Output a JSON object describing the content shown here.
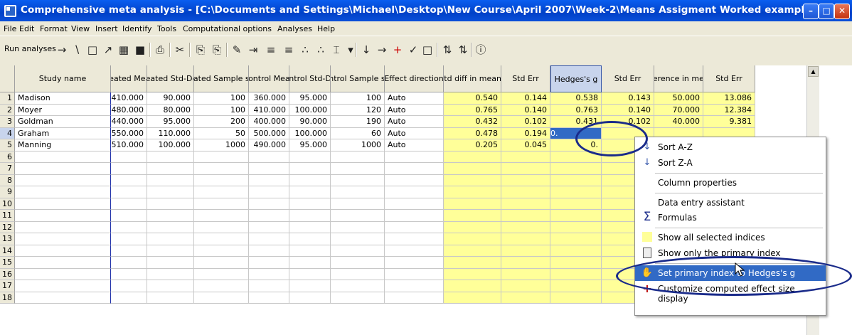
{
  "window": {
    "title": "Comprehensive meta analysis - [C:\\Documents and Settings\\Michael\\Desktop\\New Course\\April 2007\\Week-2\\Means Assigment Worked example.cma]",
    "min_glyph": "–",
    "max_glyph": "□",
    "close_glyph": "✕"
  },
  "menu": [
    "File",
    "Edit",
    "Format",
    "View",
    "Insert",
    "Identify",
    "Tools",
    "Computational options",
    "Analyses",
    "Help"
  ],
  "toolbar": {
    "run_label": "Run analyses",
    "icons": [
      "→",
      "∖",
      "□",
      "↗",
      "▦",
      "■",
      "⎙",
      "✂",
      "⎘",
      "⎘",
      "✎",
      "⇥",
      "≡",
      "≡",
      "∴",
      "∴",
      "⌶",
      "▾",
      "↓",
      "→",
      "+",
      "✓",
      "□",
      "⇅",
      "⇅",
      "ⓘ"
    ]
  },
  "grid": {
    "columns": [
      "Study name",
      "Treated Mean",
      "Treated Std-Dev",
      "Treated Sample size",
      "Control Mean",
      "Control Std-Dev",
      "Control Sample size",
      "Effect direction",
      "Std diff in means",
      "Std Err",
      "Hedges's g",
      "Std Err",
      "Difference in means",
      "Std Err"
    ],
    "rows": [
      {
        "n": "1",
        "name": "Madison",
        "tm": "410.000",
        "tsd": "90.000",
        "tn": "100",
        "cm": "360.000",
        "csd": "95.000",
        "cn": "100",
        "dir": "Auto",
        "d": "0.540",
        "dse": "0.144",
        "g": "0.538",
        "gse": "0.143",
        "diff": "50.000",
        "diffse": "13.086"
      },
      {
        "n": "2",
        "name": "Moyer",
        "tm": "480.000",
        "tsd": "80.000",
        "tn": "100",
        "cm": "410.000",
        "csd": "100.000",
        "cn": "120",
        "dir": "Auto",
        "d": "0.765",
        "dse": "0.140",
        "g": "0.763",
        "gse": "0.140",
        "diff": "70.000",
        "diffse": "12.384"
      },
      {
        "n": "3",
        "name": "Goldman",
        "tm": "440.000",
        "tsd": "95.000",
        "tn": "200",
        "cm": "400.000",
        "csd": "90.000",
        "cn": "190",
        "dir": "Auto",
        "d": "0.432",
        "dse": "0.102",
        "g": "0.431",
        "gse": "0.102",
        "diff": "40.000",
        "diffse": "9.381"
      },
      {
        "n": "4",
        "name": "Graham",
        "tm": "550.000",
        "tsd": "110.000",
        "tn": "50",
        "cm": "500.000",
        "csd": "100.000",
        "cn": "60",
        "dir": "Auto",
        "d": "0.478",
        "dse": "0.194",
        "g": "0.",
        "gse": "",
        "diff": "",
        "diffse": ""
      },
      {
        "n": "5",
        "name": "Manning",
        "tm": "510.000",
        "tsd": "100.000",
        "tn": "1000",
        "cm": "490.000",
        "csd": "95.000",
        "cn": "1000",
        "dir": "Auto",
        "d": "0.205",
        "dse": "0.045",
        "g": "0.",
        "gse": "",
        "diff": "",
        "diffse": ""
      }
    ],
    "empty_rows": [
      "6",
      "7",
      "8",
      "9",
      "10",
      "11",
      "12",
      "13",
      "14",
      "15",
      "16",
      "17",
      "18"
    ]
  },
  "context_menu": {
    "items": [
      {
        "icon": "↓",
        "label": "Sort A-Z"
      },
      {
        "icon": "↓",
        "label": "Sort Z-A"
      },
      {
        "icon": "",
        "label": "Column properties"
      },
      {
        "icon": "",
        "label": "Data entry assistant"
      },
      {
        "icon": "Σ",
        "label": "Formulas"
      },
      {
        "icon": "",
        "label": "Show all selected indices"
      },
      {
        "icon": "",
        "label": "Show only the primary index"
      },
      {
        "icon": "✋",
        "label": "Set primary index to Hedges's g"
      },
      {
        "icon": "+",
        "label": "Customize computed effect size display"
      }
    ]
  },
  "colors": {
    "highlight_column": "#ffff99",
    "menu_highlight": "#316ac5",
    "annotation": "#1a2b8a"
  }
}
